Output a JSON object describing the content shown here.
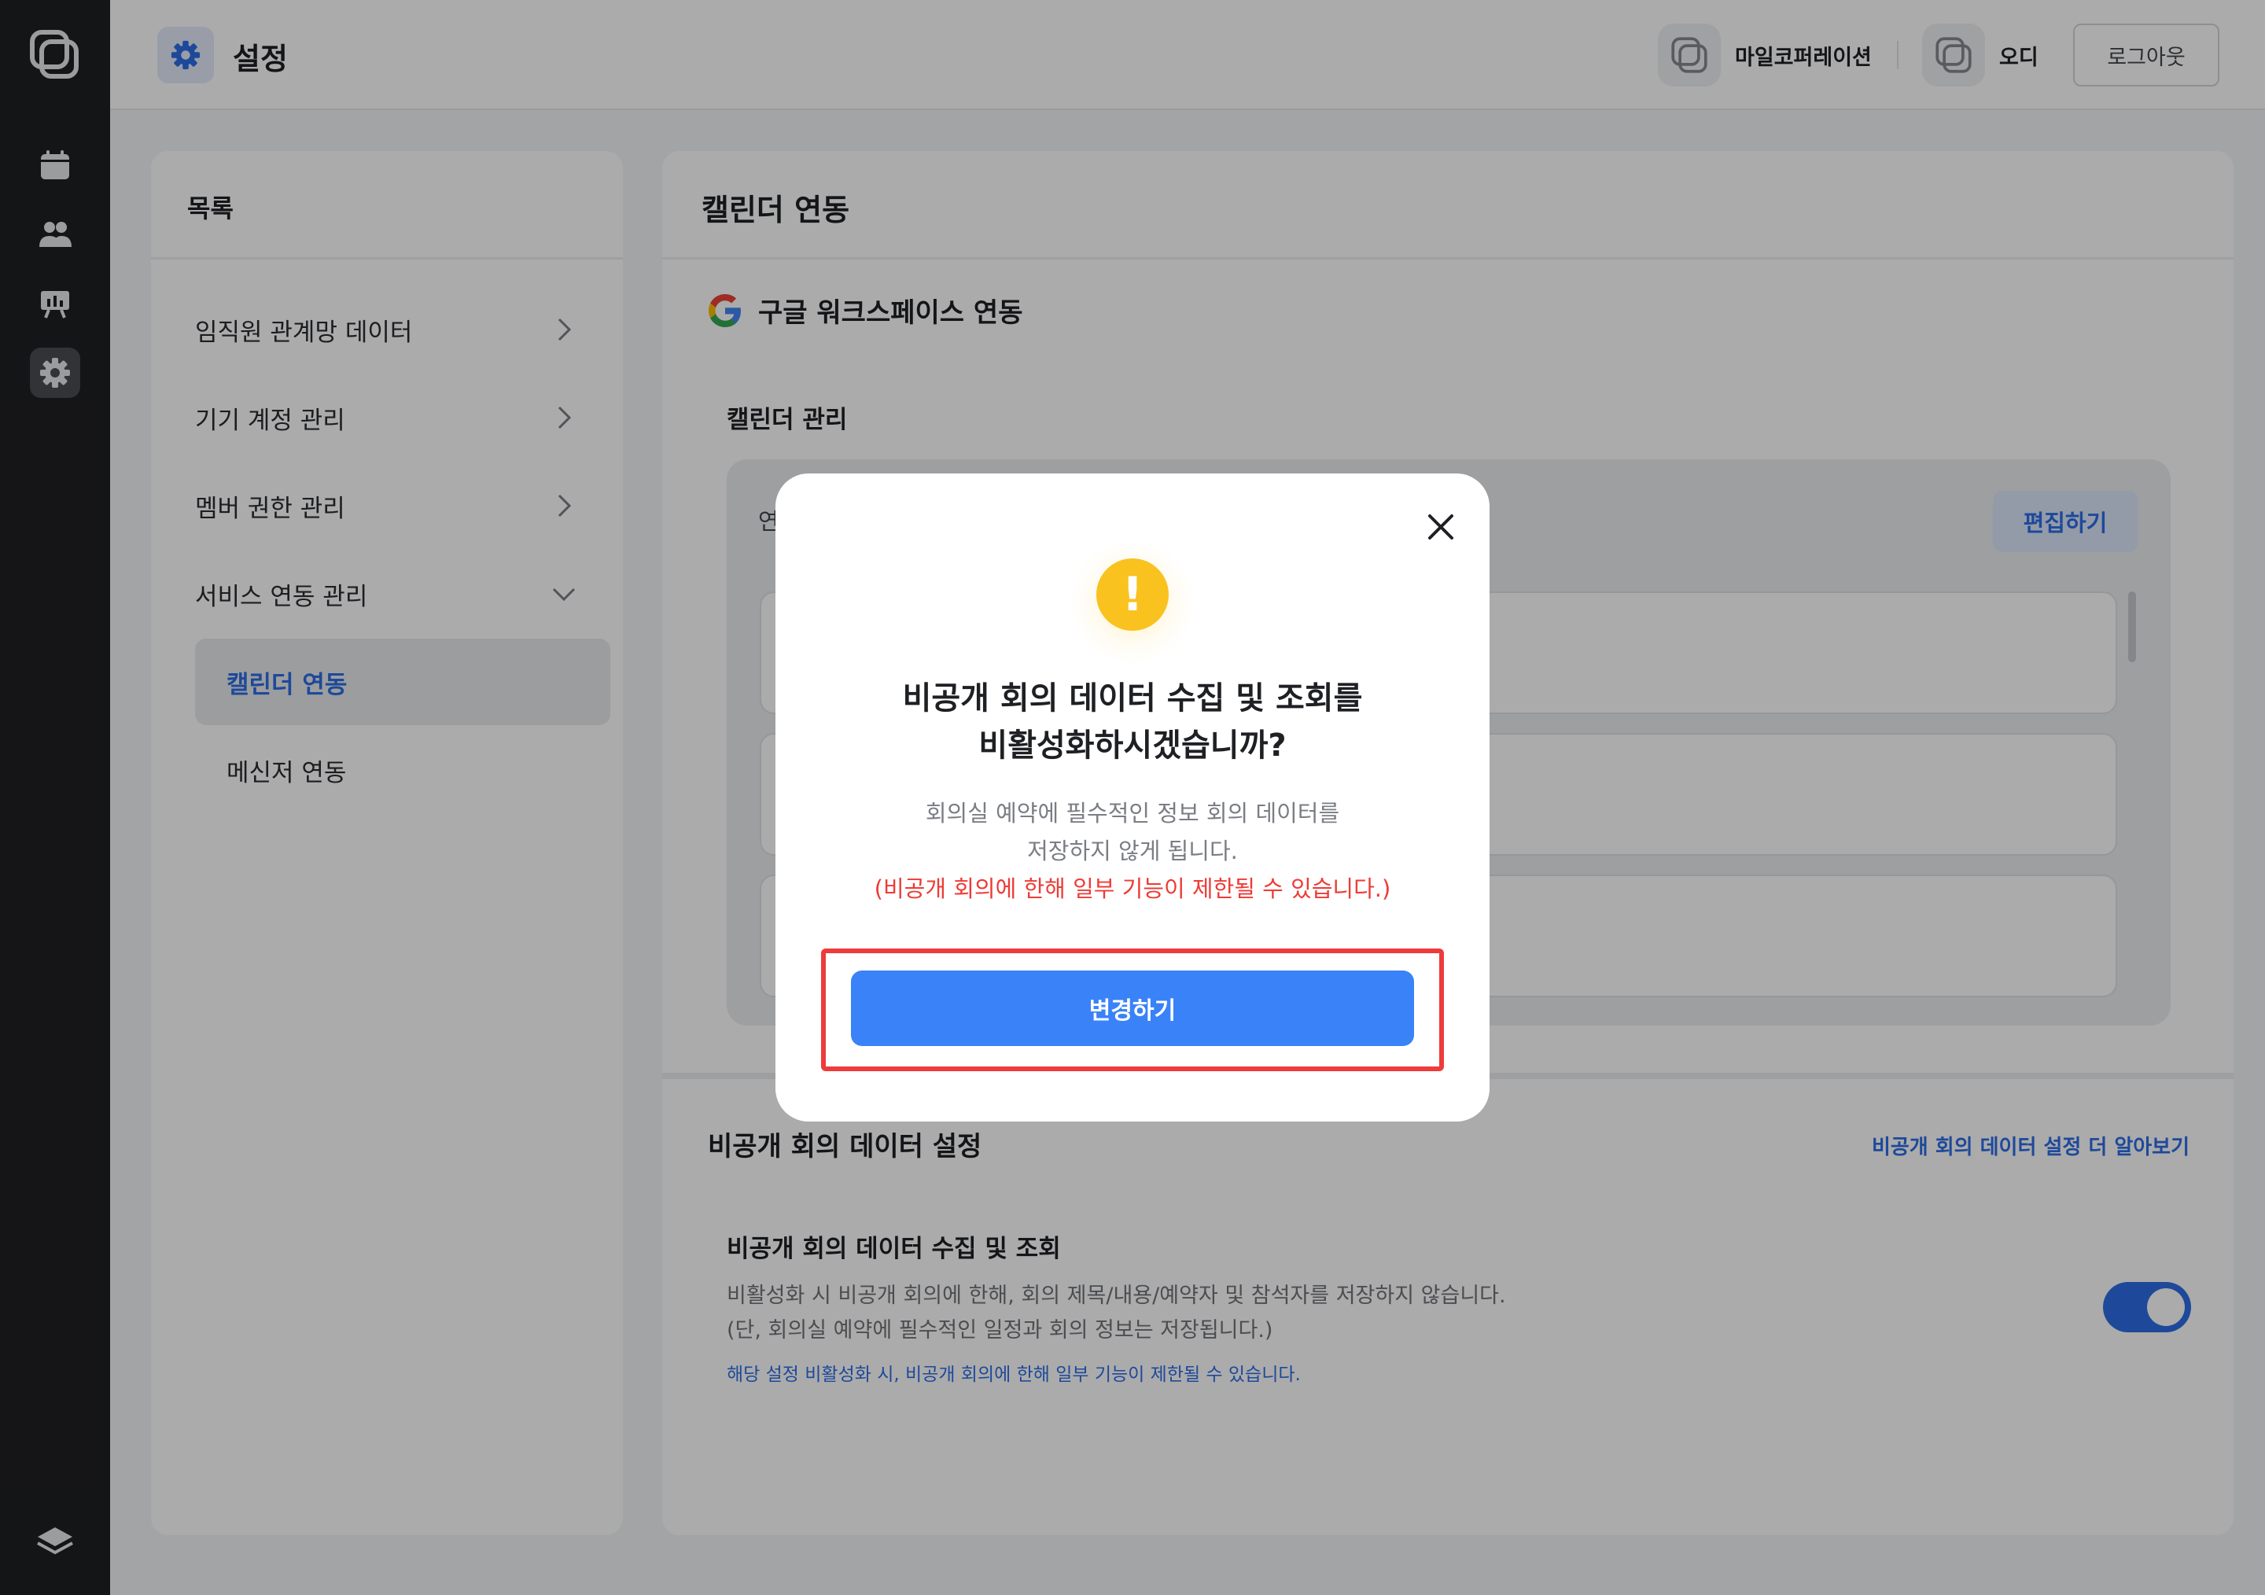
{
  "header": {
    "title": "설정",
    "org_label": "마일코퍼레이션",
    "user_label": "오디",
    "logout_label": "로그아웃"
  },
  "sidebar": {
    "title": "목록",
    "items": [
      {
        "label": "임직원 관계망 데이터",
        "icon": "chevron-right-icon"
      },
      {
        "label": "기기 계정 관리",
        "icon": "chevron-right-icon"
      },
      {
        "label": "멤버 권한 관리",
        "icon": "chevron-right-icon"
      },
      {
        "label": "서비스 연동 관리",
        "icon": "chevron-down-icon"
      }
    ],
    "sub_items": [
      {
        "label": "캘린더 연동",
        "active": true
      },
      {
        "label": "메신저 연동",
        "active": false
      }
    ]
  },
  "main": {
    "title": "캘린더 연동",
    "integration_label": "구글 워크스페이스 연동",
    "calendar_section": "캘린더 관리",
    "calendar_partial_label": "연",
    "edit_label": "편집하기",
    "private_section_title": "비공개 회의 데이터 설정",
    "learn_more_label": "비공개 회의 데이터 설정 더 알아보기",
    "private_setting_title": "비공개 회의 데이터 수집 및 조회",
    "private_setting_desc_1": "비활성화 시 비공개 회의에 한해, 회의 제목/내용/예약자 및 참석자를 저장하지 않습니다.",
    "private_setting_desc_2": "(단, 회의실 예약에 필수적인 일정과 회의 정보는 저장됩니다.)",
    "private_setting_note": "해당 설정 비활성화 시, 비공개 회의에 한해 일부 기능이 제한될 수 있습니다.",
    "toggle_on": true
  },
  "modal": {
    "title_line_1": "비공개 회의 데이터 수집 및 조회를",
    "title_line_2": "비활성화하시겠습니까?",
    "desc_line_1": "회의실 예약에 필수적인 정보 회의 데이터를",
    "desc_line_2": "저장하지 않게 됩니다.",
    "warning": "(비공개 회의에 한해 일부 기능이 제한될 수 있습니다.)",
    "confirm_label": "변경하기",
    "icon": "warning-icon"
  },
  "colors": {
    "accent": "#2e6ee6",
    "confirm_button": "#3a82f7",
    "warning_text": "#ee3b36",
    "warning_icon": "#f9c21f",
    "rail": "#1f2023"
  }
}
